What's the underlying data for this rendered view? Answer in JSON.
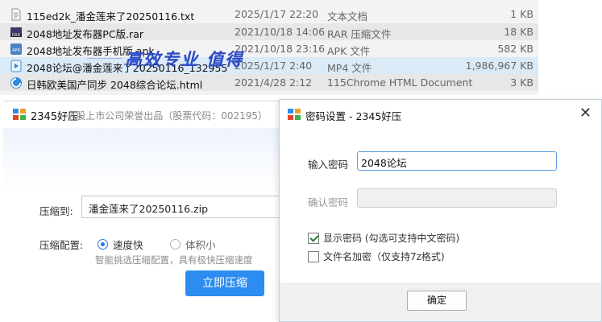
{
  "files": [
    {
      "name": "115ed2k_潘金莲来了20250116.txt",
      "date": "2025/1/17 22:20",
      "type": "文本文档",
      "size": "1 KB",
      "icon": "text-file-icon",
      "row": "normal"
    },
    {
      "name": "2048地址发布器PC版.rar",
      "date": "2021/10/18 14:06",
      "type": "RAR 压缩文件",
      "size": "18 KB",
      "icon": "rar-file-icon",
      "row": "gray"
    },
    {
      "name": "2048地址发布器手机版.apk",
      "date": "2021/10/18 23:16",
      "type": "APK 文件",
      "size": "582 KB",
      "icon": "apk-file-icon",
      "row": "normal"
    },
    {
      "name": "2048论坛@潘金莲来了20250116_132955...",
      "date": "2025/1/17 2:40",
      "type": "MP4 文件",
      "size": "1,986,967 KB",
      "icon": "mp4-file-icon",
      "row": "selected"
    },
    {
      "name": "日韩欧美国产同步 2048综合论坛.html",
      "date": "2021/4/28 2:12",
      "type": "115Chrome HTML Document",
      "size": "3 KB",
      "icon": "html-file-icon",
      "row": "gray"
    }
  ],
  "main_window": {
    "title": "2345好压-",
    "subtitle": "A股上市公司荣誉出品（股票代码：002195）",
    "slogan": "高效专业  值得",
    "compress_to_label": "压缩到:",
    "zip_path": "潘金莲来了20250116.zip",
    "config_label": "压缩配置:",
    "option_fast": "速度快",
    "option_small": "体积小",
    "config_hint": "智能挑选压缩配置，具有极快压缩速度",
    "compress_button": "立即压缩"
  },
  "password_dialog": {
    "title": "密码设置 - 2345好压",
    "close_glyph": "✕",
    "password_label": "输入密码",
    "password_value": "2048论坛",
    "confirm_label": "确认密码",
    "confirm_value": "",
    "show_password_label": "显示密码 (勾选可支持中文密码)",
    "show_password_checked": true,
    "encrypt_filenames_label": "文件名加密（仅支持7z格式)",
    "encrypt_filenames_checked": false,
    "ok_button": "确定"
  },
  "colors": {
    "accent_blue": "#2c8cf0",
    "slogan_blue": "#2f4cc6",
    "selected_row": "#dbeaf7"
  }
}
